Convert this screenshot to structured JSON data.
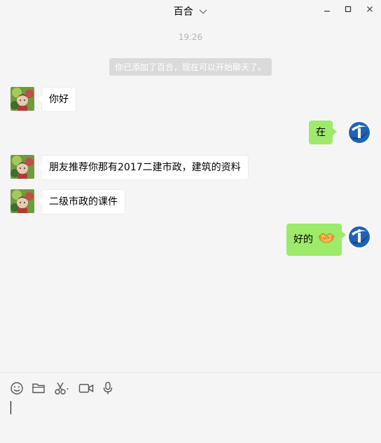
{
  "window": {
    "title": "百合",
    "title_icon": "chevron-down-icon",
    "controls": [
      "minimize-icon",
      "maximize-icon",
      "close-icon"
    ]
  },
  "chat": {
    "timestamp": "19:26",
    "system_message": "你已添加了百合，现在可以开始聊天了。",
    "messages": [
      {
        "side": "left",
        "text": "你好"
      },
      {
        "side": "right",
        "text": "在"
      },
      {
        "side": "left",
        "text": "朋友推荐你那有2017二建市政，建筑的资料"
      },
      {
        "side": "left",
        "text": "二级市政的课件"
      },
      {
        "side": "right",
        "text": "好的",
        "emoji": "handshake"
      }
    ]
  },
  "input_toolbar": {
    "tools": [
      "emoji-icon",
      "folder-icon",
      "scissors-icon",
      "video-call-icon",
      "microphone-icon"
    ]
  },
  "colors": {
    "background": "#f5f5f5",
    "outgoing_bubble": "#9eea6a",
    "incoming_bubble": "#ffffff",
    "system_message_bg": "#dadada"
  }
}
